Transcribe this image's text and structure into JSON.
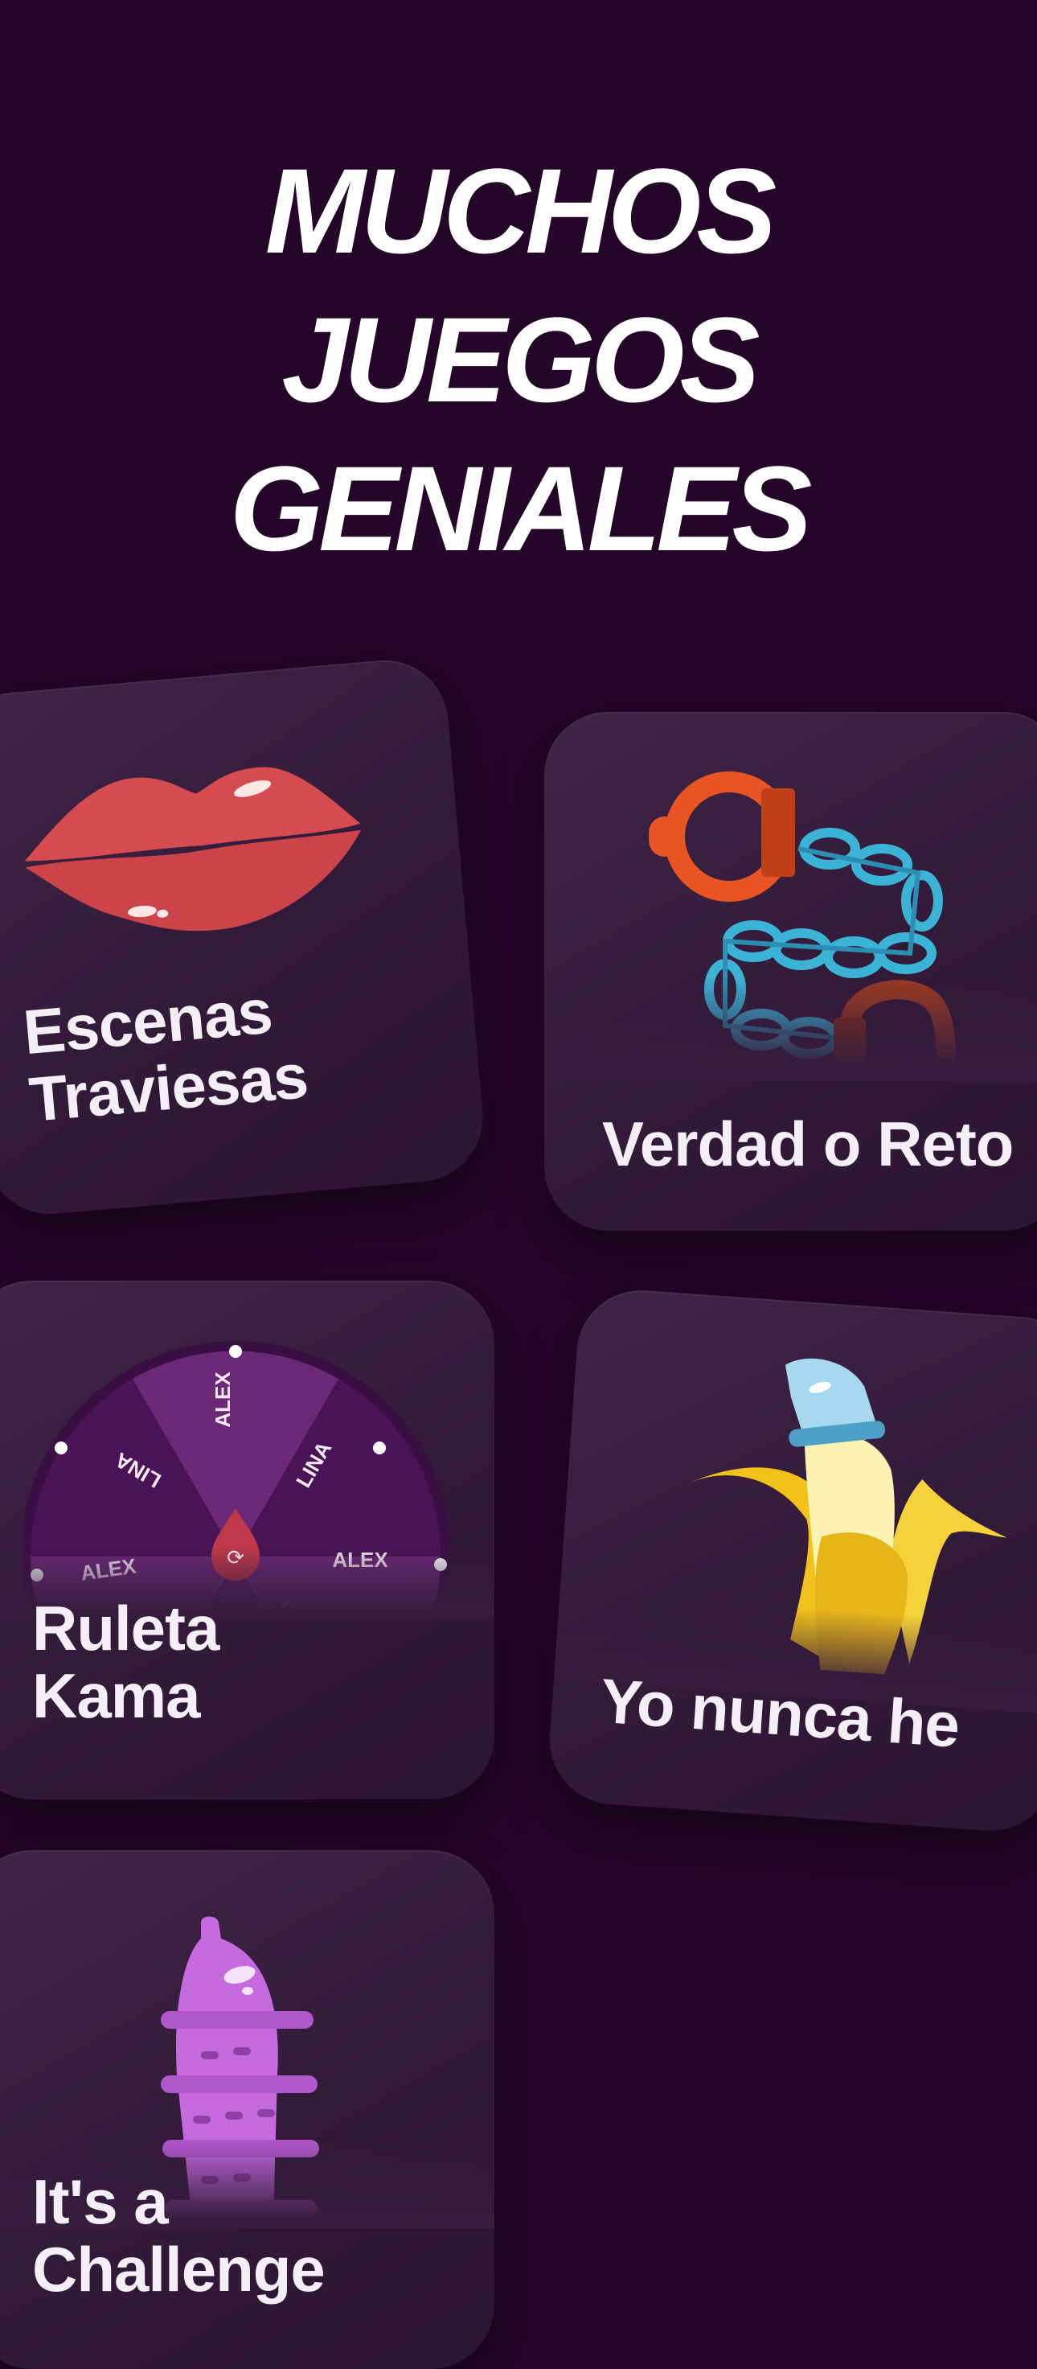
{
  "headline": {
    "line1": "MUCHOS",
    "line2": "JUEGOS",
    "line3": "GENIALES"
  },
  "games": [
    {
      "title": "Escenas\nTraviesas",
      "icon": "lips-icon"
    },
    {
      "title": "Verdad o Reto",
      "icon": "handcuffs-icon"
    },
    {
      "title": "Ruleta\nKama",
      "icon": "spin-wheel-icon",
      "wheel_labels": [
        "ALEX",
        "LINA",
        "ALEX",
        "LINA",
        "ALEX",
        "LINA"
      ]
    },
    {
      "title": "Yo nunca he",
      "icon": "banana-condom-icon"
    },
    {
      "title": "It's a\nChallenge",
      "icon": "condom-icon"
    }
  ],
  "colors": {
    "background": "#240628",
    "card": "#361c3d",
    "lips": "#d64b4f",
    "cuff": "#e85424",
    "chain": "#3ab3d6",
    "wheel": "#5b1e68",
    "banana": "#f2c21b",
    "condom_blue": "#a8d8f0",
    "condom_purple": "#c66ae0"
  }
}
